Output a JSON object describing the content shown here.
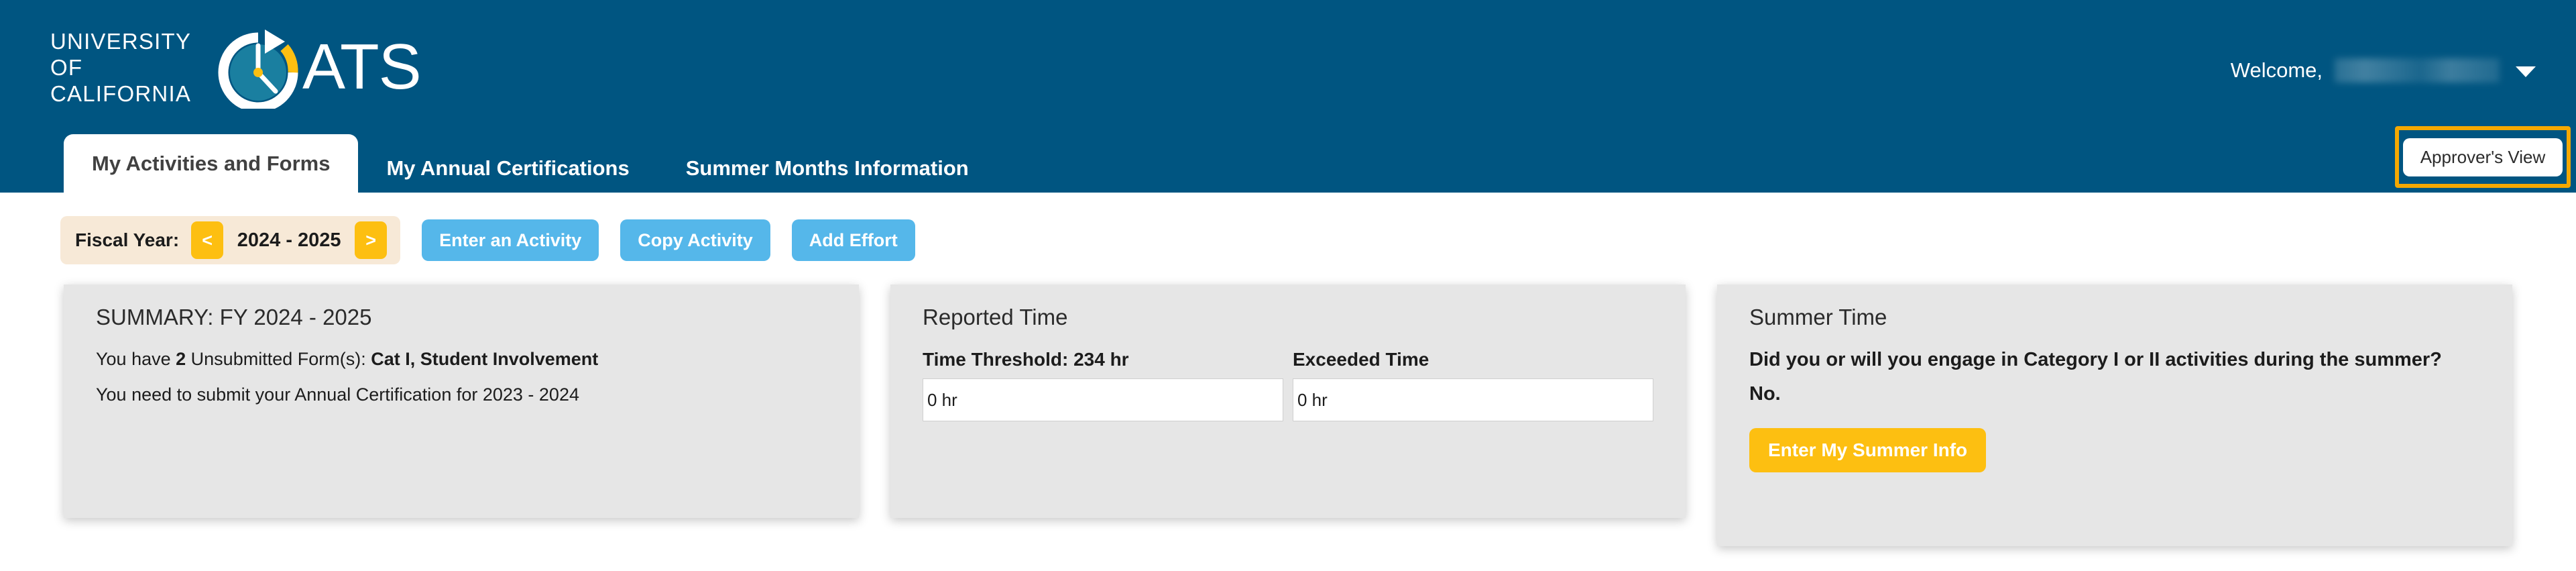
{
  "header": {
    "brand": {
      "uc_line1": "UNIVERSITY",
      "uc_line2": "OF",
      "uc_line3": "CALIFORNIA",
      "app_name": "ATS",
      "logo_icon": "oats-clock-icon"
    },
    "welcome_label": "Welcome,",
    "welcome_name": "",
    "account_caret_icon": "chevron-down-icon",
    "background_color": "#005581"
  },
  "tabs": [
    {
      "label": "My Activities and Forms",
      "active": true
    },
    {
      "label": "My Annual Certifications",
      "active": false
    },
    {
      "label": "Summer Months Information",
      "active": false
    }
  ],
  "approver": {
    "button_label": "Approver's View",
    "highlight_color": "#F5A800"
  },
  "toolbar": {
    "fiscal_label": "Fiscal Year:",
    "prev_label": "<",
    "next_label": ">",
    "fiscal_value": "2024 - 2025",
    "enter_activity_label": "Enter an Activity",
    "copy_activity_label": "Copy Activity",
    "add_effort_label": "Add Effort",
    "action_color": "#55B7EA",
    "nav_color": "#FDBF11",
    "fiscal_bg_color": "#F7E9D7"
  },
  "summary_card": {
    "title": "SUMMARY: FY 2024 - 2025",
    "line1_pre": "You have ",
    "line1_count": "2",
    "line1_mid": " Unsubmitted Form(s): ",
    "line1_forms": "Cat I, Student Involvement",
    "line2": "You need to submit your Annual Certification for 2023 - 2024"
  },
  "reported_time_card": {
    "title": "Reported Time",
    "threshold_label": "Time Threshold: 234 hr",
    "threshold_value": "0 hr",
    "exceeded_label": "Exceeded Time",
    "exceeded_value": "0 hr"
  },
  "summer_time_card": {
    "title": "Summer Time",
    "question": "Did you or will you engage in Category I or II activities during the summer?",
    "answer": "No.",
    "button_label": "Enter My Summer Info",
    "button_color": "#FDBF11"
  }
}
